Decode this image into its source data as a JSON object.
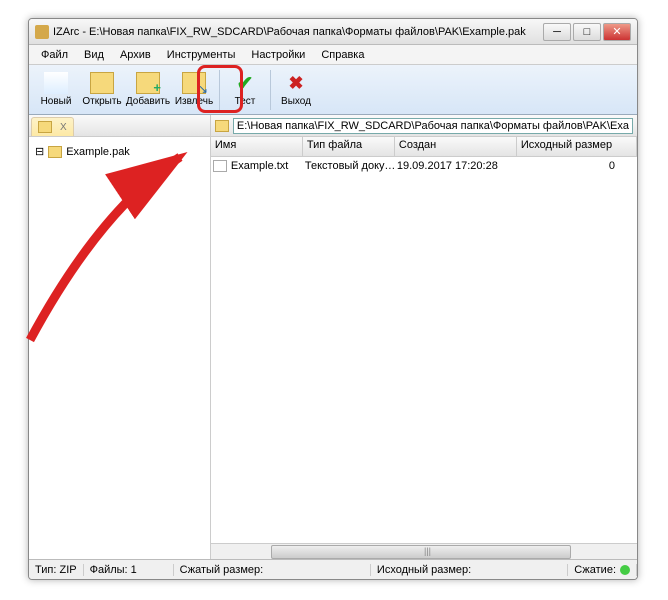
{
  "window": {
    "title": "IZArc - E:\\Новая папка\\FIX_RW_SDCARD\\Рабочая папка\\Форматы файлов\\PAK\\Example.pak"
  },
  "menu": {
    "file": "Файл",
    "view": "Вид",
    "archive": "Архив",
    "tools": "Инструменты",
    "settings": "Настройки",
    "help": "Справка"
  },
  "toolbar": {
    "new": "Новый",
    "open": "Открыть",
    "add": "Добавить",
    "extract": "Извлечь",
    "test": "Тест",
    "exit": "Выход"
  },
  "tree": {
    "tab_close": "X",
    "root": "Example.pak"
  },
  "address": {
    "path": "E:\\Новая папка\\FIX_RW_SDCARD\\Рабочая папка\\Форматы файлов\\PAK\\Exa"
  },
  "columns": {
    "name": "Имя",
    "type": "Тип файла",
    "created": "Создан",
    "orig_size": "Исходный размер"
  },
  "files": [
    {
      "name": "Example.txt",
      "type": "Текстовый докум...",
      "created": "19.09.2017 17:20:28",
      "size": "0"
    }
  ],
  "status": {
    "type_label": "Тип:",
    "type_value": "ZIP",
    "files_label": "Файлы:",
    "files_value": "1",
    "packed_label": "Сжатый размер:",
    "orig_label": "Исходный размер:",
    "ratio_label": "Сжатие:"
  },
  "scroll_marker": "|||"
}
